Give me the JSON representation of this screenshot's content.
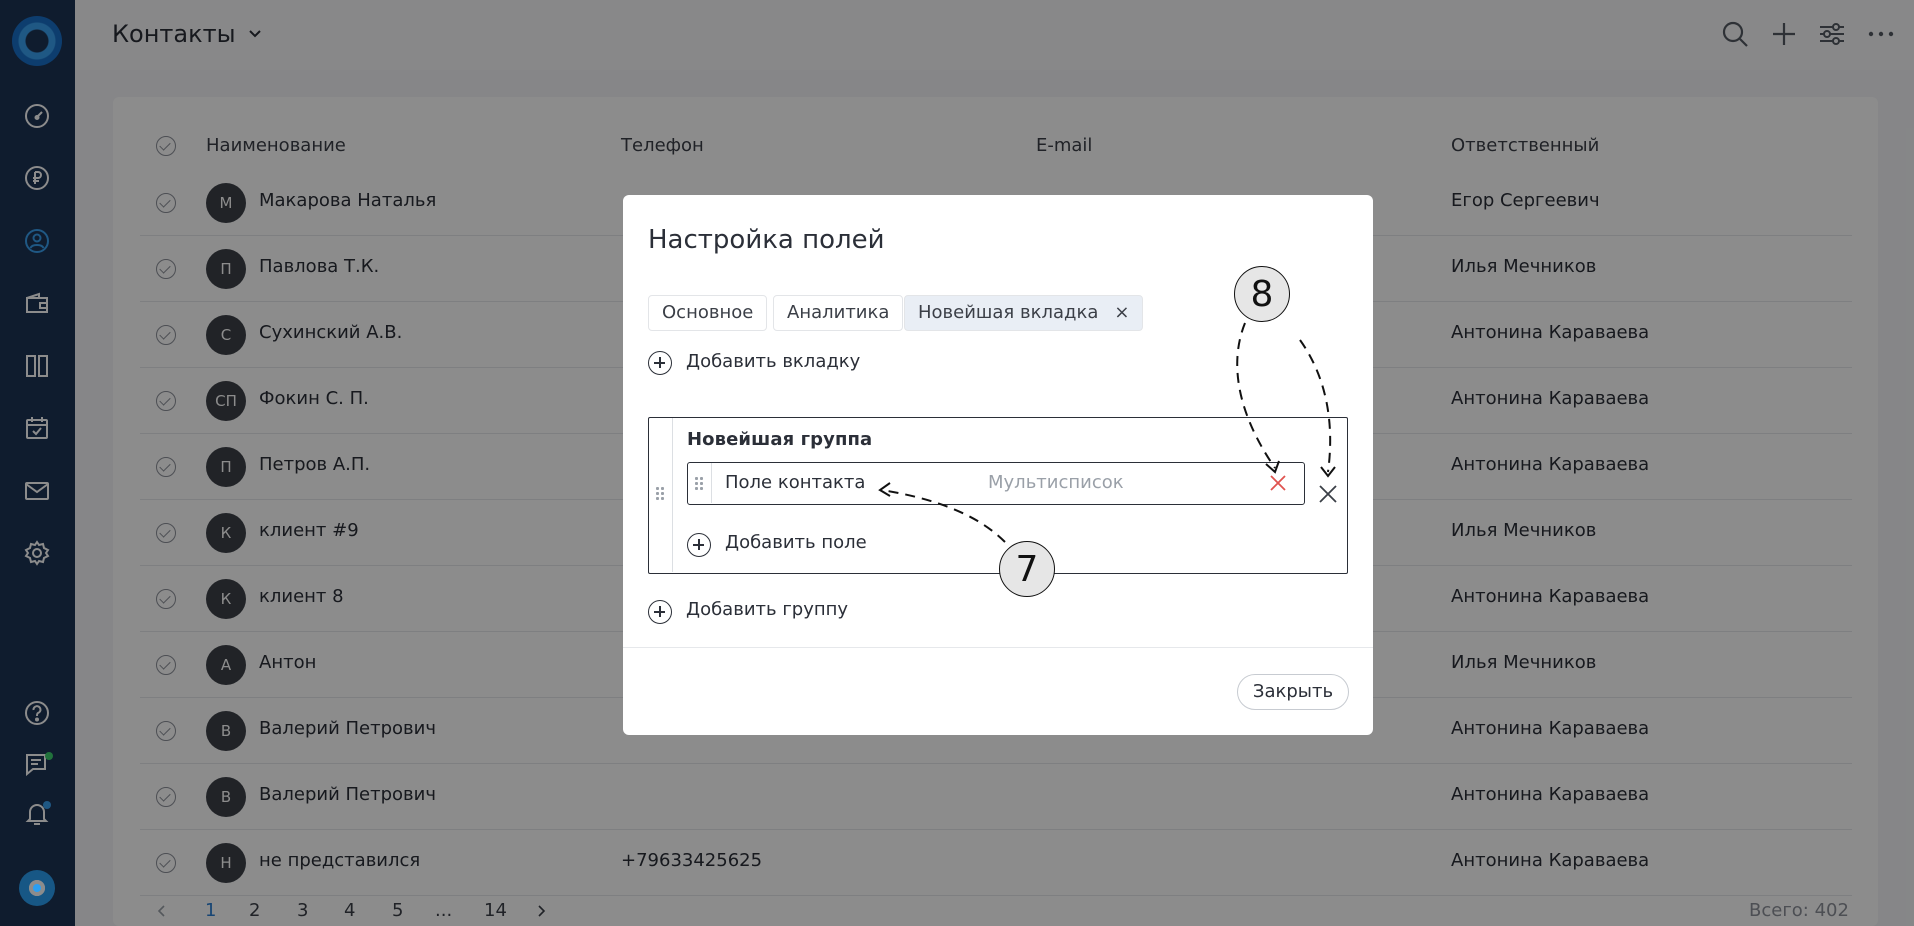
{
  "header": {
    "title": "Контакты"
  },
  "table": {
    "columns": [
      "Наименование",
      "Телефон",
      "E-mail",
      "Ответственный"
    ],
    "rows": [
      {
        "initials": "М",
        "name": "Макарова Наталья",
        "phone": "",
        "email": "",
        "responsible": "Егор Сергеевич"
      },
      {
        "initials": "П",
        "name": "Павлова Т.К.",
        "phone": "",
        "email": "",
        "responsible": "Илья Мечников"
      },
      {
        "initials": "С",
        "name": "Сухинский А.В.",
        "phone": "",
        "email": "",
        "responsible": "Антонина Караваева"
      },
      {
        "initials": "СП",
        "name": "Фокин С. П.",
        "phone": "",
        "email": "",
        "responsible": "Антонина Караваева"
      },
      {
        "initials": "П",
        "name": "Петров А.П.",
        "phone": "",
        "email": "",
        "responsible": "Антонина Караваева"
      },
      {
        "initials": "К",
        "name": "клиент #9",
        "phone": "",
        "email": "",
        "responsible": "Илья Мечников"
      },
      {
        "initials": "К",
        "name": "клиент 8",
        "phone": "",
        "email": "",
        "responsible": "Антонина Караваева"
      },
      {
        "initials": "А",
        "name": "Антон",
        "phone": "",
        "email": "",
        "responsible": "Илья Мечников"
      },
      {
        "initials": "В",
        "name": "Валерий Петрович",
        "phone": "",
        "email": "",
        "responsible": "Антонина Караваева"
      },
      {
        "initials": "В",
        "name": "Валерий Петрович",
        "phone": "",
        "email": "",
        "responsible": "Антонина Караваева"
      },
      {
        "initials": "Н",
        "name": "не представился",
        "phone": "+79633425625",
        "email": "",
        "responsible": "Антонина Караваева"
      }
    ]
  },
  "pagination": {
    "pages": [
      "1",
      "2",
      "3",
      "4",
      "5",
      "...",
      "14"
    ],
    "current": "1",
    "total_label": "Всего: 402"
  },
  "modal": {
    "title": "Настройка полей",
    "tabs": [
      {
        "label": "Основное"
      },
      {
        "label": "Аналитика"
      },
      {
        "label": "Новейшая вкладка",
        "close": "×"
      }
    ],
    "add_tab_label": "Добавить вкладку",
    "group": {
      "title": "Новейшая группа",
      "field": {
        "name": "Поле контакта",
        "type": "Мультисписок"
      },
      "add_field_label": "Добавить поле"
    },
    "add_group_label": "Добавить группу",
    "close_label": "Закрыть"
  },
  "annotations": {
    "callout_7": "7",
    "callout_8": "8"
  },
  "colors": {
    "sidebar": "#1d3354",
    "accent": "#3aa0f0",
    "remove_red": "#e0534f"
  }
}
